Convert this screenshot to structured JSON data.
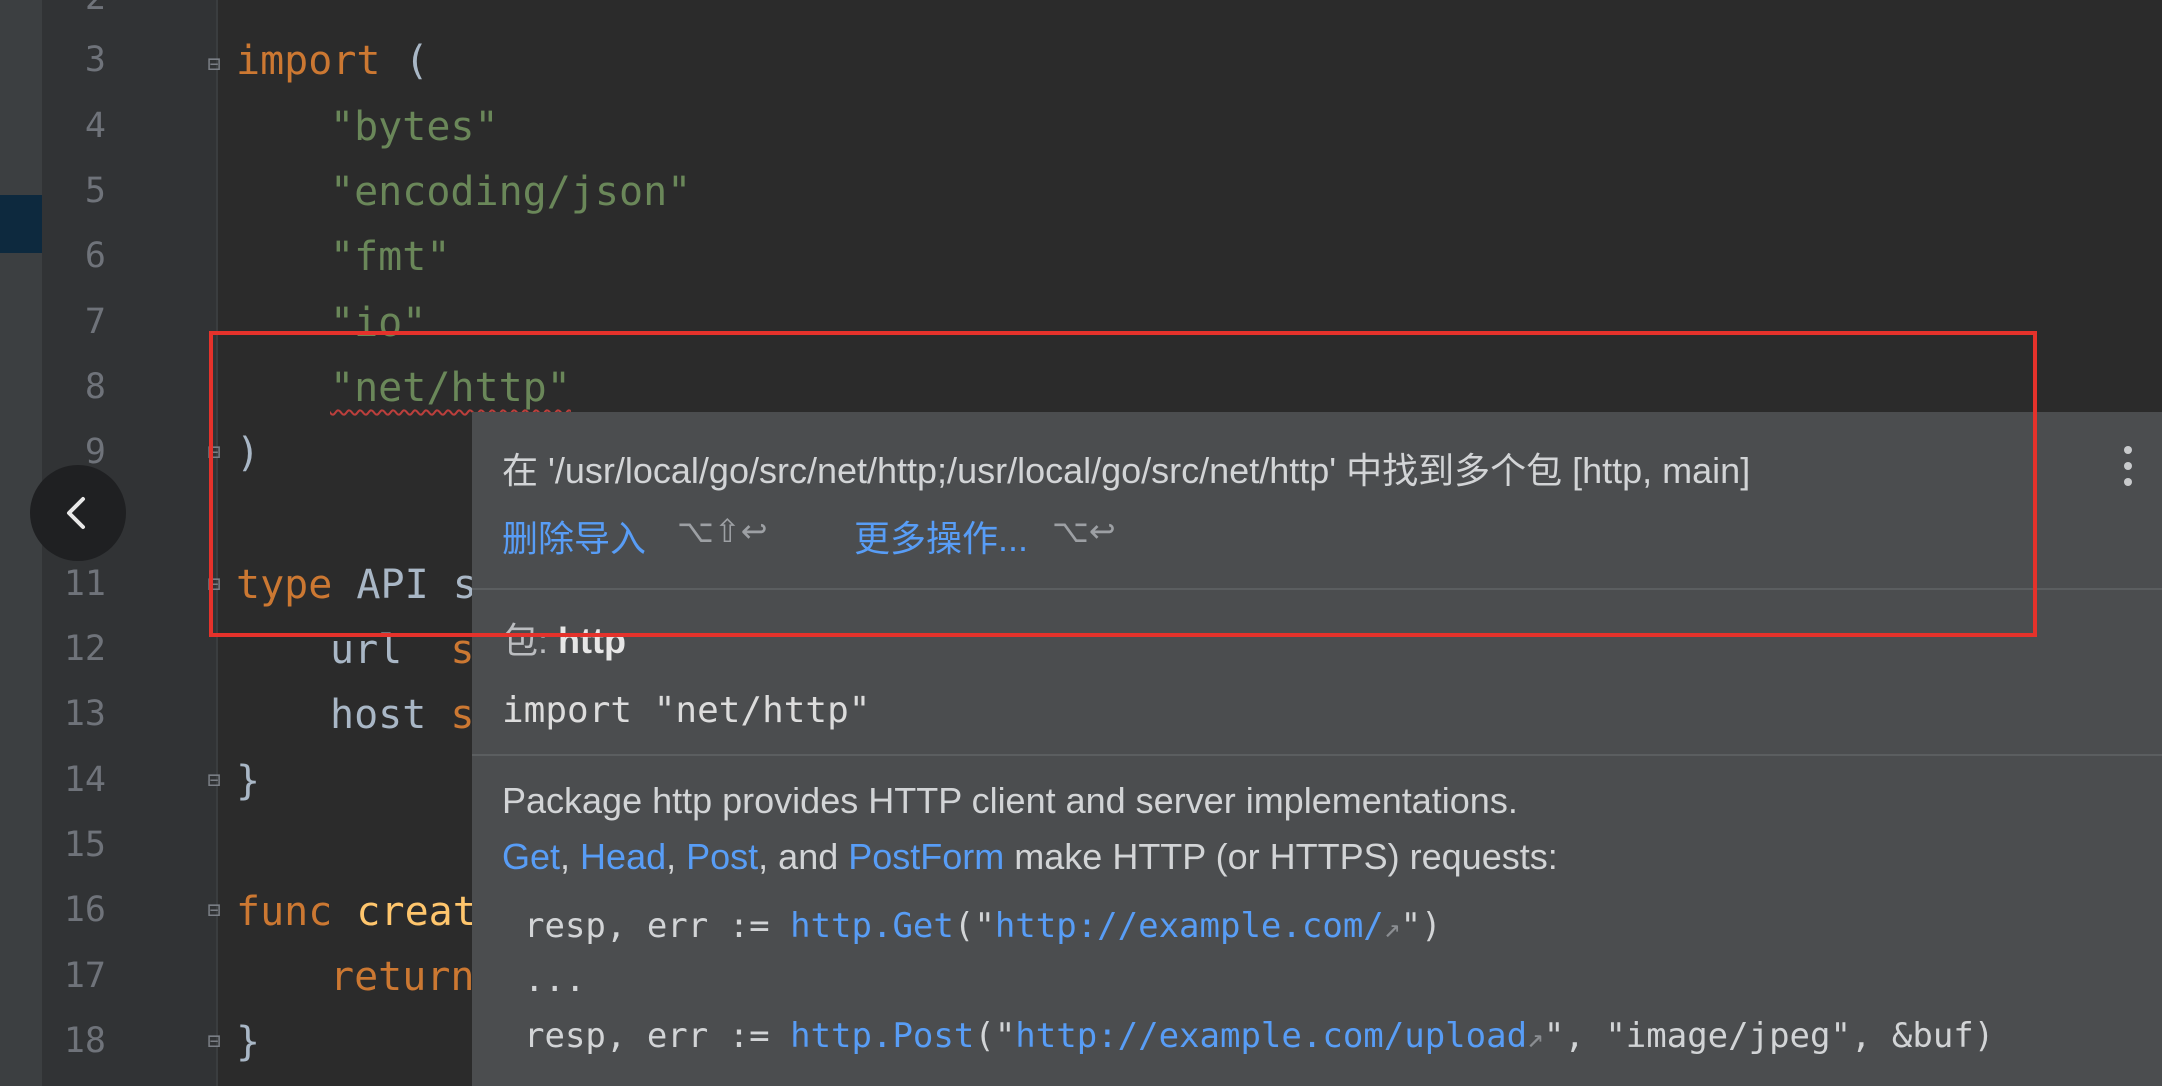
{
  "editor": {
    "line_numbers": [
      "2",
      "3",
      "4",
      "5",
      "6",
      "7",
      "8",
      "9",
      "11",
      "12",
      "13",
      "14",
      "15",
      "16",
      "17",
      "18"
    ],
    "lines": {
      "l3_kw": "import",
      "l3_rest": " (",
      "l4": "\"bytes\"",
      "l5": "\"encoding/json\"",
      "l6": "\"fmt\"",
      "l7": "\"io\"",
      "l8": "\"net/http\"",
      "l9": ")",
      "l11_kw": "type",
      "l11_rest": " API s",
      "l12_a": "url  ",
      "l12_b": "s",
      "l13_a": "host ",
      "l13_b": "s",
      "l14": "}",
      "l16_kw": "func",
      "l16_rest": " creat",
      "l17_kw": "return",
      "l18": "}"
    }
  },
  "popup": {
    "message": "在 '/usr/local/go/src/net/http;/usr/local/go/src/net/http' 中找到多个包 [http, main]",
    "action_remove": "删除导入",
    "shortcut_remove": "⌥⇧↩",
    "action_more": "更多操作...",
    "shortcut_more": "⌥↩",
    "package_label": "包:",
    "package_name": "http",
    "import_statement": "import \"net/http\"",
    "doc_line1": "Package http provides HTTP client and server implementations.",
    "doc_links": [
      "Get",
      "Head",
      "Post",
      "PostForm"
    ],
    "doc_sep1": ", ",
    "doc_sep2": ", ",
    "doc_sep3": ", and ",
    "doc_line2_rest": " make HTTP (or HTTPS) requests:",
    "example": {
      "l1_prefix": "resp, err := ",
      "l1_call": "http.Get",
      "l1_open": "(\"",
      "l1_url": "http://example.com/",
      "l1_close": "\")",
      "l2": "...",
      "l3_prefix": "resp, err := ",
      "l3_call": "http.Post",
      "l3_open": "(\"",
      "l3_url": "http://example.com/upload",
      "l3_close": "\", \"image/jpeg\", &buf)"
    }
  },
  "icons": [
    "back-arrow-icon",
    "more-vertical-icon",
    "external-link-icon",
    "fold-icon"
  ],
  "colors": {
    "annotation_box": "#e5322b",
    "link": "#589df6"
  }
}
